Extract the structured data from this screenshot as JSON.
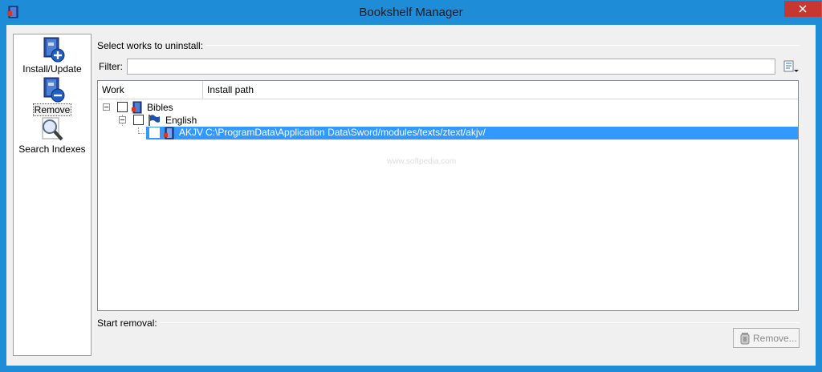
{
  "window": {
    "title": "Bookshelf Manager"
  },
  "sidebar": {
    "items": [
      {
        "label": "Install/Update",
        "icon": "book-add-icon",
        "selected": false
      },
      {
        "label": "Remove",
        "icon": "book-remove-icon",
        "selected": true
      },
      {
        "label": "Search Indexes",
        "icon": "magnifier-icon",
        "selected": false
      }
    ]
  },
  "main": {
    "select_group_label": "Select works to uninstall:",
    "filter_label": "Filter:",
    "filter_value": "",
    "columns": [
      "Work",
      "Install path"
    ],
    "tree": [
      {
        "label": "Bibles",
        "level": 0,
        "expanded": true,
        "checked": false
      },
      {
        "label": "English",
        "level": 1,
        "expanded": true,
        "checked": false
      },
      {
        "label": "AKJV",
        "path": "C:\\ProgramData\\Application Data\\Sword/modules/texts/ztext/akjv/",
        "level": 2,
        "checked": false,
        "selected": true
      }
    ],
    "start_group_label": "Start removal:",
    "remove_button_label": "Remove..."
  },
  "colors": {
    "titlebar": "#1e8cd6",
    "close": "#c7372f",
    "selection": "#3399ff"
  }
}
